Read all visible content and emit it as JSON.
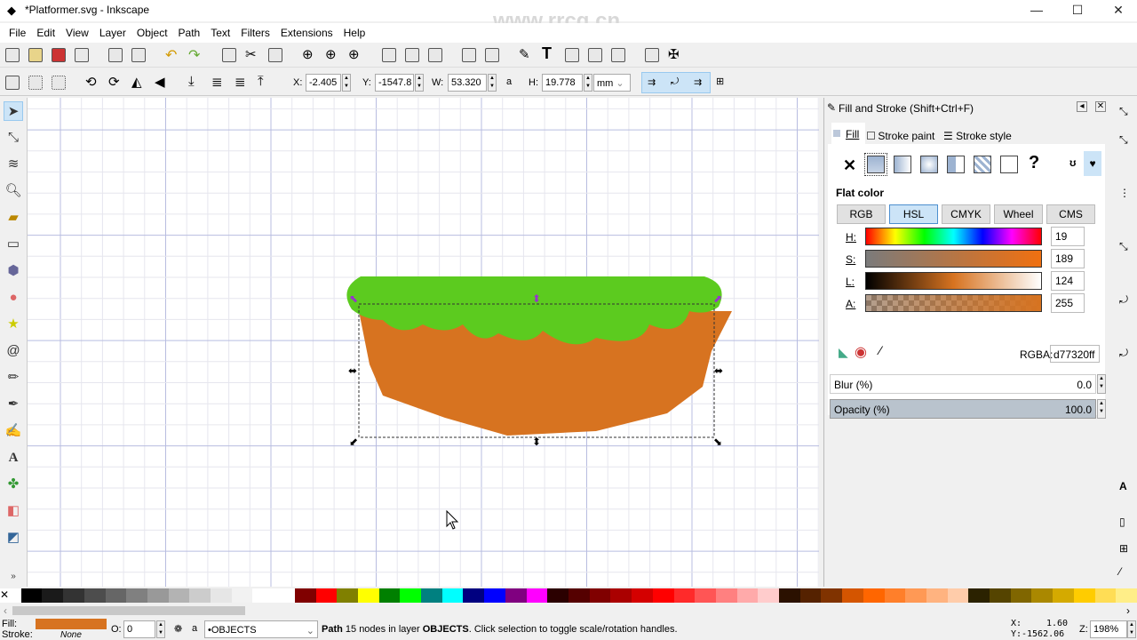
{
  "window": {
    "title": "*Platformer.svg - Inkscape",
    "minimize": "—",
    "maximize": "☐",
    "close": "✕"
  },
  "watermark": "www.rrcg.cn",
  "menu": [
    "File",
    "Edit",
    "View",
    "Layer",
    "Object",
    "Path",
    "Text",
    "Filters",
    "Extensions",
    "Help"
  ],
  "toolctl": {
    "x_label": "X:",
    "x": "-2.405",
    "y_label": "Y:",
    "y": "-1547.8",
    "w_label": "W:",
    "w": "53.320",
    "h_label": "H:",
    "h": "19.778",
    "unit": "mm"
  },
  "dialog": {
    "title": "Fill and Stroke (Shift+Ctrl+F)",
    "tabs": [
      "Fill",
      "Stroke paint",
      "Stroke style"
    ],
    "flat_color": "Flat color",
    "modes": [
      "RGB",
      "HSL",
      "CMYK",
      "Wheel",
      "CMS"
    ],
    "active_mode": "HSL",
    "sliders": [
      {
        "label": "H:",
        "value": "19"
      },
      {
        "label": "S:",
        "value": "189"
      },
      {
        "label": "L:",
        "value": "124"
      },
      {
        "label": "A:",
        "value": "255"
      }
    ],
    "rgba_label": "RGBA:",
    "rgba": "d77320ff",
    "blur_label": "Blur (%)",
    "blur": "0.0",
    "opacity_label": "Opacity (%)",
    "opacity": "100.0",
    "unknown": "?"
  },
  "colors": {
    "fill": "#d77320",
    "green": "#5ccb1f",
    "accent": "#cce4f7"
  },
  "status": {
    "fill_label": "Fill:",
    "stroke_label": "Stroke:",
    "stroke": "None",
    "o_label": "O:",
    "o": "0",
    "layer": "•OBJECTS",
    "msg_pre": "Path",
    "msg_nodes": " 15 nodes in layer ",
    "msg_layer": "OBJECTS",
    "msg_post": ". Click selection to toggle scale/rotation handles.",
    "cx_label": "X:",
    "cx": "1.60",
    "cy_label": "Y:",
    "cy": "-1562.06",
    "z_label": "Z:",
    "zoom": "198%"
  }
}
